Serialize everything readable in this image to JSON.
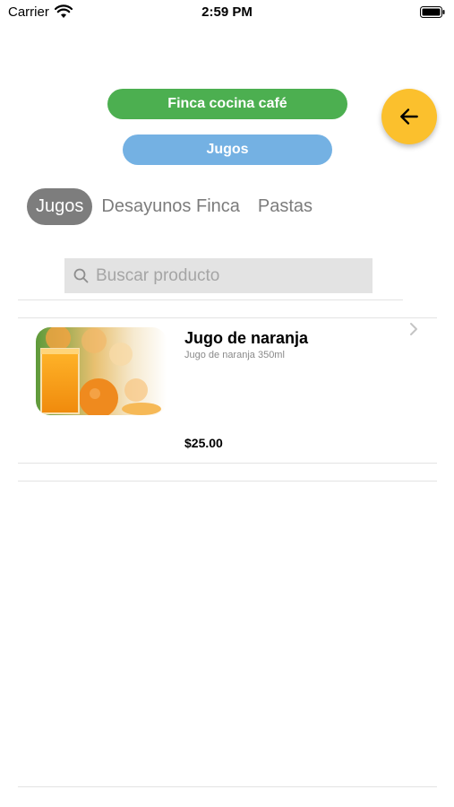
{
  "status_bar": {
    "carrier": "Carrier",
    "time": "2:59 PM"
  },
  "header": {
    "restaurant_label": "Finca cocina café",
    "category_label": "Jugos",
    "back_icon": "arrow-left-icon"
  },
  "tabs": [
    {
      "label": "Jugos",
      "active": true
    },
    {
      "label": "Desayunos Finca",
      "active": false
    },
    {
      "label": "Pastas",
      "active": false
    }
  ],
  "search": {
    "placeholder": "Buscar producto",
    "value": ""
  },
  "products": [
    {
      "name": "Jugo de naranja",
      "description": "Jugo de naranja 350ml",
      "price": "$25.00"
    }
  ],
  "colors": {
    "restaurant_pill": "#4caf50",
    "category_pill": "#74b1e3",
    "back_button": "#fbc02d",
    "active_tab": "#7d7d7d"
  }
}
